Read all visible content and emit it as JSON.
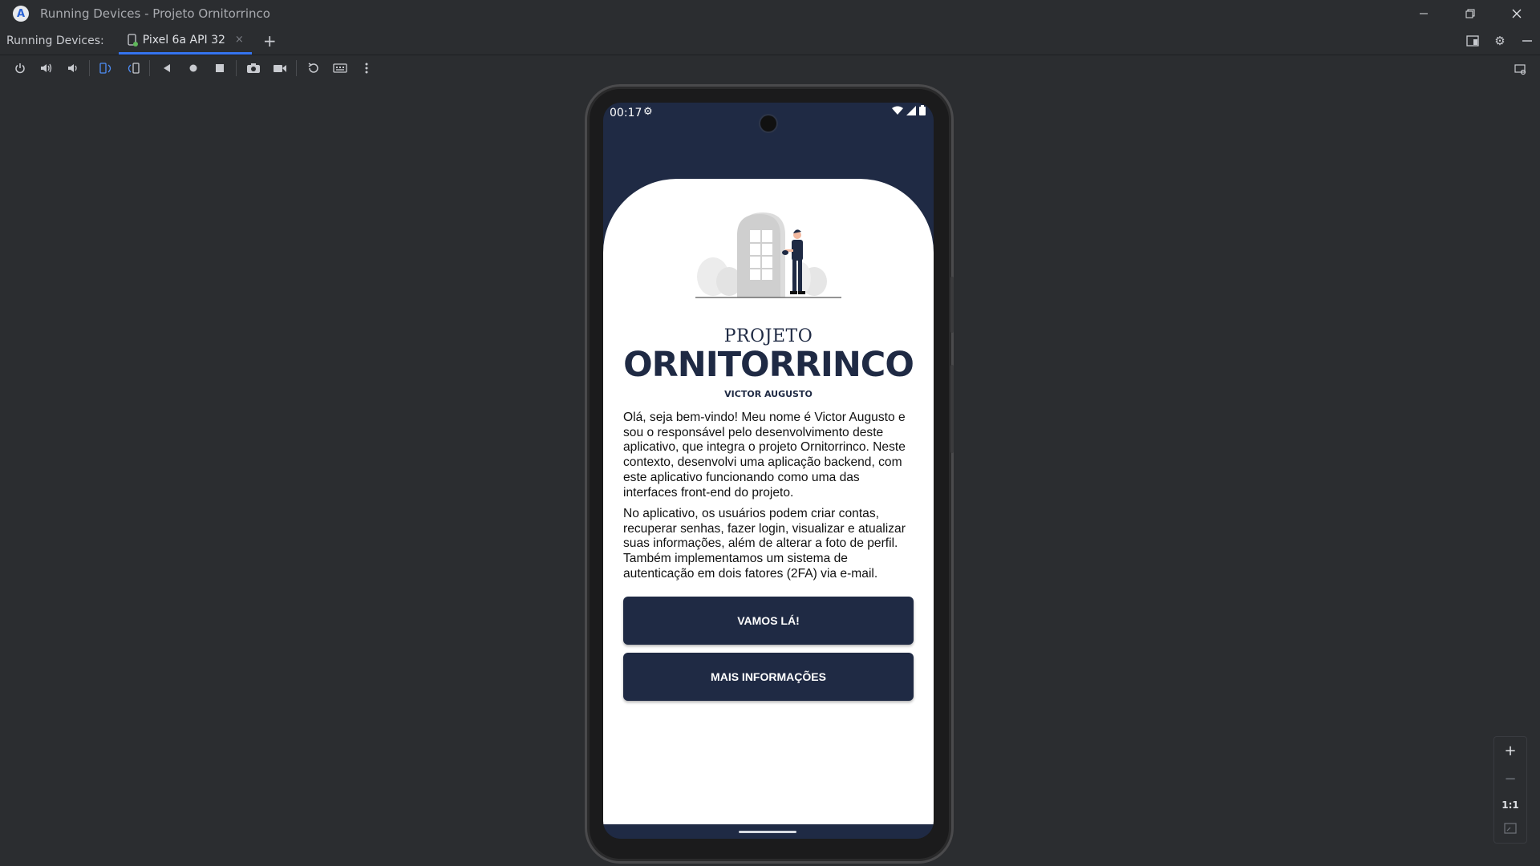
{
  "window": {
    "title": "Running Devices - Projeto Ornitorrinco",
    "controls": [
      "minimize",
      "restore",
      "close"
    ]
  },
  "tabbar": {
    "label": "Running Devices:",
    "tab_label": "Pixel 6a API 32",
    "tab_close": "×",
    "add": "+"
  },
  "toolbar": {
    "icons": [
      "power-icon",
      "volume-up-icon",
      "volume-down-icon",
      "rotate-left-icon",
      "rotate-right-icon",
      "back-icon",
      "home-icon",
      "overview-icon",
      "camera-icon",
      "video-icon",
      "reset-icon",
      "keyboard-icon",
      "more-icon"
    ]
  },
  "device": {
    "status": {
      "time": "00:17"
    },
    "brand_top": "PROJETO",
    "brand_main": "ORNITORRINCO",
    "author": "VICTOR AUGUSTO",
    "paragraph1": "Olá, seja bem-vindo! Meu nome é Victor Augusto e sou o responsável pelo desenvolvimento deste aplicativo, que integra o projeto Ornitorrinco. Neste contexto, desenvolvi uma aplicação backend, com este aplicativo funcionando como uma das interfaces front-end do projeto.",
    "paragraph2": "No aplicativo, os usuários podem criar contas, recuperar senhas, fazer login, visualizar e atualizar suas informações, além de alterar a foto de perfil. Também implementamos um sistema de autenticação em dois fatores (2FA) via e-mail.",
    "button_primary": "VAMOS LÁ!",
    "button_secondary": "MAIS INFORMAÇÕES",
    "colors": {
      "navy": "#1f2a44"
    }
  },
  "zoom": {
    "in": "+",
    "out": "−",
    "one_to_one": "1:1"
  }
}
